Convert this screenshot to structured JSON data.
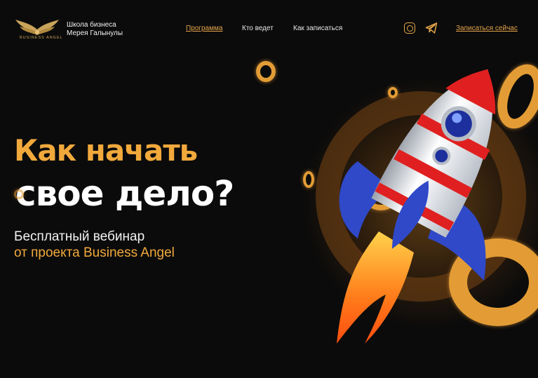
{
  "header": {
    "logo_text": "BUSINESS ANGEL",
    "brand_line1": "Школа бизнеса",
    "brand_line2": "Мерея Галынулы",
    "nav": [
      {
        "label": "Программа",
        "active": true
      },
      {
        "label": "Кто ведет",
        "active": false
      },
      {
        "label": "Как записаться",
        "active": false
      }
    ],
    "social_icons": [
      "instagram-icon",
      "telegram-icon"
    ],
    "cta_label": "Записаться сейчас"
  },
  "hero": {
    "title_line1": "Как начать",
    "title_line2": "свое дело?",
    "subtitle_line1": "Бесплатный вебинар",
    "subtitle_line2": "от проекта Business Angel"
  },
  "colors": {
    "accent": "#e5a54b",
    "title_orange": "#f1a93c",
    "background": "#0b0b0b"
  }
}
